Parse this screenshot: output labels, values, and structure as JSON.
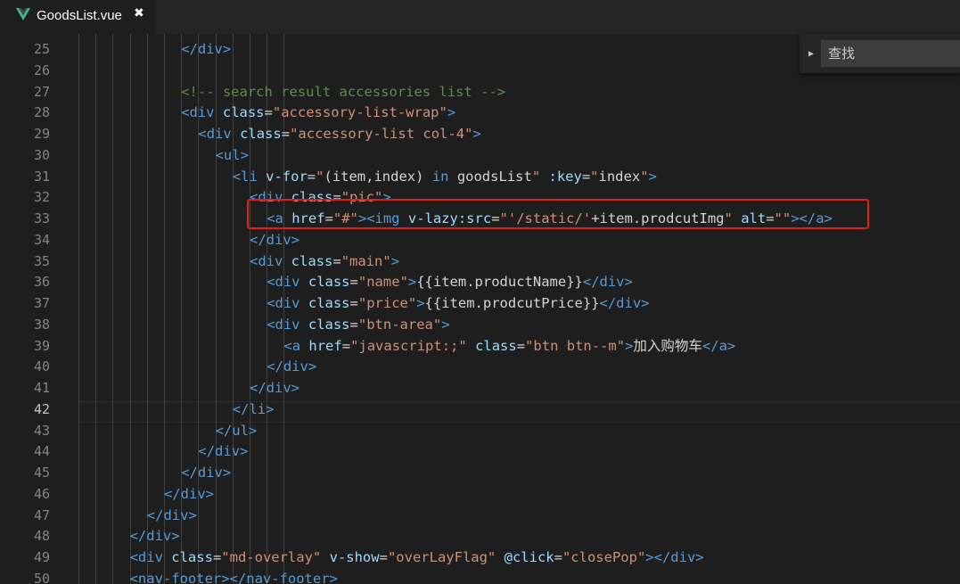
{
  "tab": {
    "filename": "GoodsList.vue",
    "close_glyph": "✖",
    "icon": "vue-logo-icon"
  },
  "find": {
    "placeholder": "查找"
  },
  "editor": {
    "active_line": "42",
    "lines": [
      {
        "n": "25",
        "indent": 6,
        "tokens": [
          [
            "tag",
            "</div>"
          ]
        ]
      },
      {
        "n": "26",
        "indent": 0,
        "tokens": []
      },
      {
        "n": "27",
        "indent": 6,
        "tokens": [
          [
            "cmt",
            "<!-- search result accessories list -->"
          ]
        ]
      },
      {
        "n": "28",
        "indent": 6,
        "tokens": [
          [
            "tag",
            "<div "
          ],
          [
            "attr",
            "class"
          ],
          [
            "txt",
            "="
          ],
          [
            "str",
            "\"accessory-list-wrap\""
          ],
          [
            "tag",
            ">"
          ]
        ]
      },
      {
        "n": "29",
        "indent": 7,
        "tokens": [
          [
            "tag",
            "<div "
          ],
          [
            "attr",
            "class"
          ],
          [
            "txt",
            "="
          ],
          [
            "str",
            "\"accessory-list col-4\""
          ],
          [
            "tag",
            ">"
          ]
        ]
      },
      {
        "n": "30",
        "indent": 8,
        "tokens": [
          [
            "tag",
            "<ul>"
          ]
        ]
      },
      {
        "n": "31",
        "indent": 9,
        "tokens": [
          [
            "tag",
            "<li "
          ],
          [
            "attr",
            "v-for"
          ],
          [
            "txt",
            "="
          ],
          [
            "str",
            "\""
          ],
          [
            "txt",
            "(item,index) "
          ],
          [
            "tag",
            "in"
          ],
          [
            "txt",
            " goodsList"
          ],
          [
            "str",
            "\""
          ],
          [
            "txt",
            " "
          ],
          [
            "attr",
            ":key"
          ],
          [
            "txt",
            "="
          ],
          [
            "str",
            "\""
          ],
          [
            "txt",
            "index"
          ],
          [
            "str",
            "\""
          ],
          [
            "tag",
            ">"
          ]
        ]
      },
      {
        "n": "32",
        "indent": 10,
        "tokens": [
          [
            "tag",
            "<div "
          ],
          [
            "attr",
            "class"
          ],
          [
            "txt",
            "="
          ],
          [
            "str",
            "\"pic\""
          ],
          [
            "tag",
            ">"
          ]
        ]
      },
      {
        "n": "33",
        "indent": 11,
        "tokens": [
          [
            "tag",
            "<a "
          ],
          [
            "attr",
            "href"
          ],
          [
            "txt",
            "="
          ],
          [
            "str",
            "\"#\""
          ],
          [
            "tag",
            "><img "
          ],
          [
            "attr",
            "v-lazy:src"
          ],
          [
            "txt",
            "="
          ],
          [
            "str",
            "\"'/static/'"
          ],
          [
            "txt",
            "+item.prodcutImg"
          ],
          [
            "str",
            "\""
          ],
          [
            "txt",
            " "
          ],
          [
            "attr",
            "alt"
          ],
          [
            "txt",
            "="
          ],
          [
            "str",
            "\"\""
          ],
          [
            "tag",
            "></a>"
          ]
        ]
      },
      {
        "n": "34",
        "indent": 10,
        "tokens": [
          [
            "tag",
            "</div>"
          ]
        ]
      },
      {
        "n": "35",
        "indent": 10,
        "tokens": [
          [
            "tag",
            "<div "
          ],
          [
            "attr",
            "class"
          ],
          [
            "txt",
            "="
          ],
          [
            "str",
            "\"main\""
          ],
          [
            "tag",
            ">"
          ]
        ]
      },
      {
        "n": "36",
        "indent": 11,
        "tokens": [
          [
            "tag",
            "<div "
          ],
          [
            "attr",
            "class"
          ],
          [
            "txt",
            "="
          ],
          [
            "str",
            "\"name\""
          ],
          [
            "tag",
            ">"
          ],
          [
            "txt",
            "{{item.productName}}"
          ],
          [
            "tag",
            "</div>"
          ]
        ]
      },
      {
        "n": "37",
        "indent": 11,
        "tokens": [
          [
            "tag",
            "<div "
          ],
          [
            "attr",
            "class"
          ],
          [
            "txt",
            "="
          ],
          [
            "str",
            "\"price\""
          ],
          [
            "tag",
            ">"
          ],
          [
            "txt",
            "{{item.prodcutPrice}}"
          ],
          [
            "tag",
            "</div>"
          ]
        ]
      },
      {
        "n": "38",
        "indent": 11,
        "tokens": [
          [
            "tag",
            "<div "
          ],
          [
            "attr",
            "class"
          ],
          [
            "txt",
            "="
          ],
          [
            "str",
            "\"btn-area\""
          ],
          [
            "tag",
            ">"
          ]
        ]
      },
      {
        "n": "39",
        "indent": 12,
        "tokens": [
          [
            "tag",
            "<a "
          ],
          [
            "attr",
            "href"
          ],
          [
            "txt",
            "="
          ],
          [
            "str",
            "\"javascript:;\""
          ],
          [
            "txt",
            " "
          ],
          [
            "attr",
            "class"
          ],
          [
            "txt",
            "="
          ],
          [
            "str",
            "\"btn btn--m\""
          ],
          [
            "tag",
            ">"
          ],
          [
            "txt",
            "加入购物车"
          ],
          [
            "tag",
            "</a>"
          ]
        ]
      },
      {
        "n": "40",
        "indent": 11,
        "tokens": [
          [
            "tag",
            "</div>"
          ]
        ]
      },
      {
        "n": "41",
        "indent": 10,
        "tokens": [
          [
            "tag",
            "</div>"
          ]
        ]
      },
      {
        "n": "42",
        "indent": 9,
        "tokens": [
          [
            "tag",
            "</li>"
          ]
        ]
      },
      {
        "n": "43",
        "indent": 8,
        "tokens": [
          [
            "tag",
            "</ul>"
          ]
        ]
      },
      {
        "n": "44",
        "indent": 7,
        "tokens": [
          [
            "tag",
            "</div>"
          ]
        ]
      },
      {
        "n": "45",
        "indent": 6,
        "tokens": [
          [
            "tag",
            "</div>"
          ]
        ]
      },
      {
        "n": "46",
        "indent": 5,
        "tokens": [
          [
            "tag",
            "</div>"
          ]
        ]
      },
      {
        "n": "47",
        "indent": 4,
        "tokens": [
          [
            "tag",
            "</div>"
          ]
        ]
      },
      {
        "n": "48",
        "indent": 3,
        "tokens": [
          [
            "tag",
            "</div>"
          ]
        ]
      },
      {
        "n": "49",
        "indent": 3,
        "tokens": [
          [
            "tag",
            "<div "
          ],
          [
            "attr",
            "class"
          ],
          [
            "txt",
            "="
          ],
          [
            "str",
            "\"md-overlay\""
          ],
          [
            "txt",
            " "
          ],
          [
            "attr",
            "v-show"
          ],
          [
            "txt",
            "="
          ],
          [
            "str",
            "\"overLayFlag\""
          ],
          [
            "txt",
            " "
          ],
          [
            "attr",
            "@click"
          ],
          [
            "txt",
            "="
          ],
          [
            "str",
            "\"closePop\""
          ],
          [
            "tag",
            "></div>"
          ]
        ]
      },
      {
        "n": "50",
        "indent": 3,
        "tokens": [
          [
            "tag",
            "<nav-footer></nav-footer>"
          ]
        ]
      }
    ]
  },
  "colors": {
    "tag": "#569cd6",
    "attr": "#9cdcfe",
    "string": "#ce9178",
    "comment": "#608b4e",
    "highlight_box": "#e0211b"
  }
}
